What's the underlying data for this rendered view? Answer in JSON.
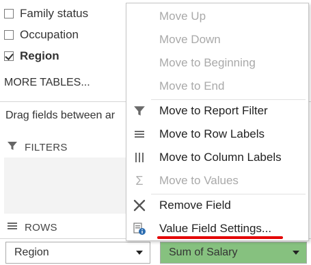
{
  "fields": [
    {
      "label": "Family status",
      "checked": false
    },
    {
      "label": "Occupation",
      "checked": false
    },
    {
      "label": "Region",
      "checked": true
    }
  ],
  "more_tables": "MORE TABLES...",
  "drag_text": "Drag fields between ar",
  "areas": {
    "filters": "FILTERS",
    "rows": "ROWS"
  },
  "bottom": {
    "rows_value": "Region",
    "values_value": "Sum of Salary",
    "values_bg": "#86c17f"
  },
  "menu": {
    "items": [
      {
        "label": "Move Up",
        "enabled": false,
        "icon": "none"
      },
      {
        "label": "Move Down",
        "enabled": false,
        "icon": "none"
      },
      {
        "label": "Move to Beginning",
        "enabled": false,
        "icon": "none"
      },
      {
        "label": "Move to End",
        "enabled": false,
        "icon": "none"
      },
      {
        "label": "Move to Report Filter",
        "enabled": true,
        "icon": "filter-icon"
      },
      {
        "label": "Move to Row Labels",
        "enabled": true,
        "icon": "rows-icon"
      },
      {
        "label": "Move to Column Labels",
        "enabled": true,
        "icon": "columns-icon"
      },
      {
        "label": "Move to Values",
        "enabled": false,
        "icon": "sigma-icon"
      },
      {
        "label": "Remove Field",
        "enabled": true,
        "icon": "x-icon"
      },
      {
        "label": "Value Field Settings...",
        "enabled": true,
        "icon": "field-settings-icon"
      }
    ]
  }
}
